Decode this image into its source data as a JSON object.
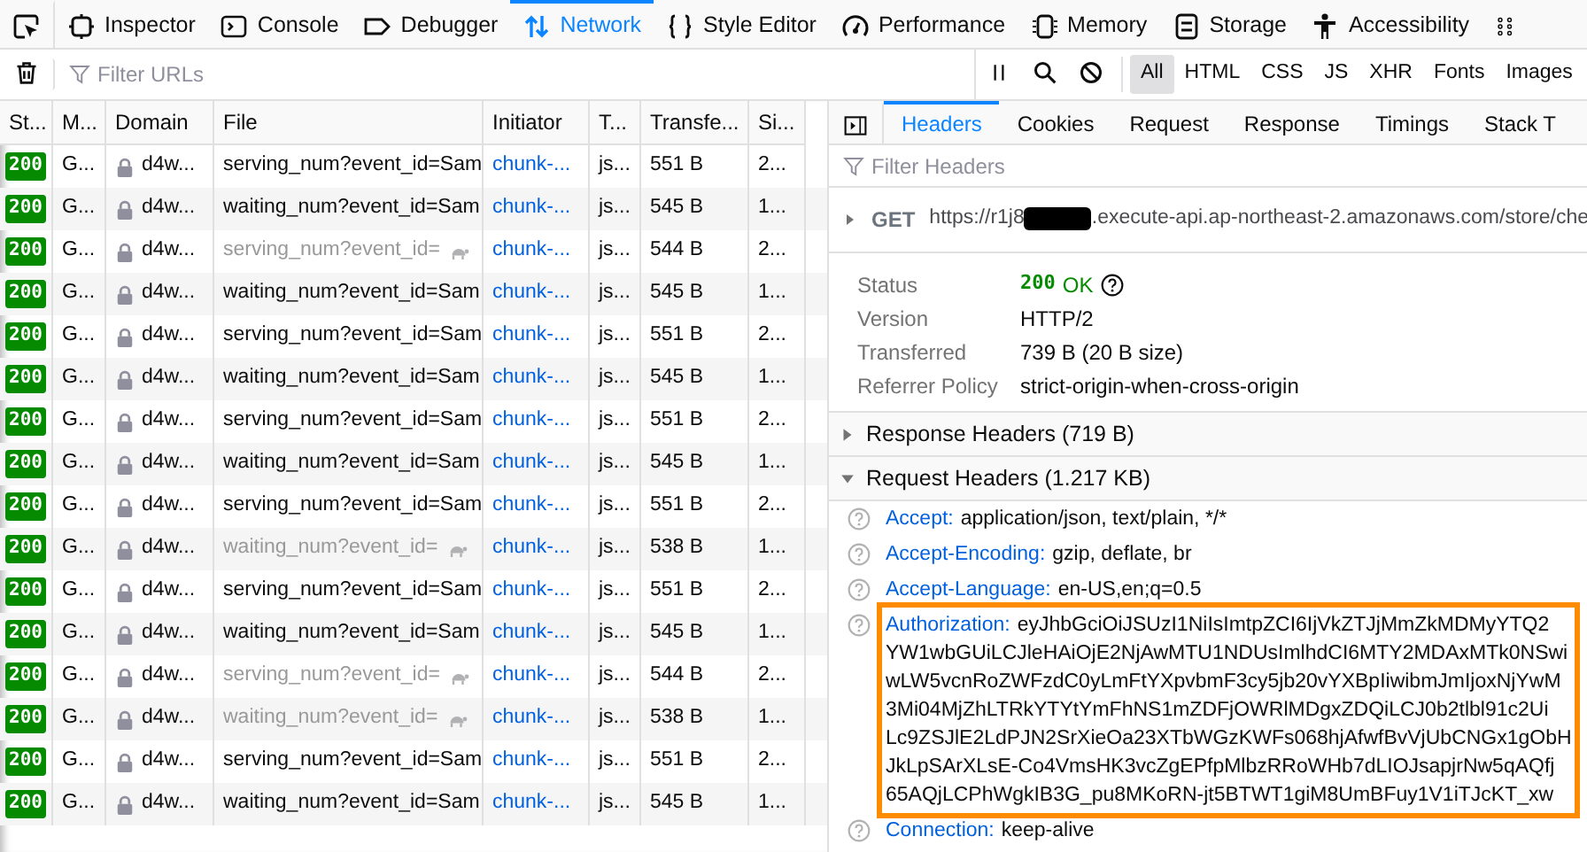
{
  "toolbox_tabs": [
    {
      "label": "Inspector",
      "selected": false
    },
    {
      "label": "Console",
      "selected": false
    },
    {
      "label": "Debugger",
      "selected": false
    },
    {
      "label": "Network",
      "selected": true
    },
    {
      "label": "Style Editor",
      "selected": false
    },
    {
      "label": "Performance",
      "selected": false
    },
    {
      "label": "Memory",
      "selected": false
    },
    {
      "label": "Storage",
      "selected": false
    },
    {
      "label": "Accessibility",
      "selected": false
    }
  ],
  "filter": {
    "placeholder": "Filter URLs"
  },
  "type_filters": [
    {
      "label": "All",
      "selected": true
    },
    {
      "label": "HTML",
      "selected": false
    },
    {
      "label": "CSS",
      "selected": false
    },
    {
      "label": "JS",
      "selected": false
    },
    {
      "label": "XHR",
      "selected": false
    },
    {
      "label": "Fonts",
      "selected": false
    },
    {
      "label": "Images",
      "selected": false
    }
  ],
  "table": {
    "columns": [
      "St...",
      "M...",
      "Domain",
      "File",
      "Initiator",
      "T...",
      "Transfe...",
      "Si..."
    ],
    "rows": [
      {
        "status": "200",
        "method": "G...",
        "domain": "d4w...",
        "file": "serving_num?event_id=Sam",
        "throttled": false,
        "initiator": "chunk-...",
        "type": "js...",
        "transferred": "551 B",
        "size": "2..."
      },
      {
        "status": "200",
        "method": "G...",
        "domain": "d4w...",
        "file": "waiting_num?event_id=Sam",
        "throttled": false,
        "initiator": "chunk-...",
        "type": "js...",
        "transferred": "545 B",
        "size": "1..."
      },
      {
        "status": "200",
        "method": "G...",
        "domain": "d4w...",
        "file": "serving_num?event_id=",
        "throttled": true,
        "initiator": "chunk-...",
        "type": "js...",
        "transferred": "544 B",
        "size": "2..."
      },
      {
        "status": "200",
        "method": "G...",
        "domain": "d4w...",
        "file": "waiting_num?event_id=Sam",
        "throttled": false,
        "initiator": "chunk-...",
        "type": "js...",
        "transferred": "545 B",
        "size": "1..."
      },
      {
        "status": "200",
        "method": "G...",
        "domain": "d4w...",
        "file": "serving_num?event_id=Sam",
        "throttled": false,
        "initiator": "chunk-...",
        "type": "js...",
        "transferred": "551 B",
        "size": "2..."
      },
      {
        "status": "200",
        "method": "G...",
        "domain": "d4w...",
        "file": "waiting_num?event_id=Sam",
        "throttled": false,
        "initiator": "chunk-...",
        "type": "js...",
        "transferred": "545 B",
        "size": "1..."
      },
      {
        "status": "200",
        "method": "G...",
        "domain": "d4w...",
        "file": "serving_num?event_id=Sam",
        "throttled": false,
        "initiator": "chunk-...",
        "type": "js...",
        "transferred": "551 B",
        "size": "2..."
      },
      {
        "status": "200",
        "method": "G...",
        "domain": "d4w...",
        "file": "waiting_num?event_id=Sam",
        "throttled": false,
        "initiator": "chunk-...",
        "type": "js...",
        "transferred": "545 B",
        "size": "1..."
      },
      {
        "status": "200",
        "method": "G...",
        "domain": "d4w...",
        "file": "serving_num?event_id=Sam",
        "throttled": false,
        "initiator": "chunk-...",
        "type": "js...",
        "transferred": "551 B",
        "size": "2..."
      },
      {
        "status": "200",
        "method": "G...",
        "domain": "d4w...",
        "file": "waiting_num?event_id=",
        "throttled": true,
        "initiator": "chunk-...",
        "type": "js...",
        "transferred": "538 B",
        "size": "1..."
      },
      {
        "status": "200",
        "method": "G...",
        "domain": "d4w...",
        "file": "serving_num?event_id=Sam",
        "throttled": false,
        "initiator": "chunk-...",
        "type": "js...",
        "transferred": "551 B",
        "size": "2..."
      },
      {
        "status": "200",
        "method": "G...",
        "domain": "d4w...",
        "file": "waiting_num?event_id=Sam",
        "throttled": false,
        "initiator": "chunk-...",
        "type": "js...",
        "transferred": "545 B",
        "size": "1..."
      },
      {
        "status": "200",
        "method": "G...",
        "domain": "d4w...",
        "file": "serving_num?event_id=",
        "throttled": true,
        "initiator": "chunk-...",
        "type": "js...",
        "transferred": "544 B",
        "size": "2..."
      },
      {
        "status": "200",
        "method": "G...",
        "domain": "d4w...",
        "file": "waiting_num?event_id=",
        "throttled": true,
        "initiator": "chunk-...",
        "type": "js...",
        "transferred": "538 B",
        "size": "1..."
      },
      {
        "status": "200",
        "method": "G...",
        "domain": "d4w...",
        "file": "serving_num?event_id=Sam",
        "throttled": false,
        "initiator": "chunk-...",
        "type": "js...",
        "transferred": "551 B",
        "size": "2..."
      },
      {
        "status": "200",
        "method": "G...",
        "domain": "d4w...",
        "file": "waiting_num?event_id=Sam",
        "throttled": false,
        "initiator": "chunk-...",
        "type": "js...",
        "transferred": "545 B",
        "size": "1..."
      }
    ]
  },
  "detail_tabs": [
    {
      "label": "Headers",
      "selected": true
    },
    {
      "label": "Cookies",
      "selected": false
    },
    {
      "label": "Request",
      "selected": false
    },
    {
      "label": "Response",
      "selected": false
    },
    {
      "label": "Timings",
      "selected": false
    },
    {
      "label": "Stack T",
      "selected": false
    }
  ],
  "header_filter": {
    "placeholder": "Filter Headers"
  },
  "request_line": {
    "method": "GET",
    "url_start": "https://r1j8",
    "redacted": true,
    "url_end": ".execute-api.ap-northeast-2.amazonaws.com/store/che"
  },
  "summary": [
    {
      "label": "Status",
      "value": "OK",
      "code": "200"
    },
    {
      "label": "Version",
      "value": "HTTP/2"
    },
    {
      "label": "Transferred",
      "value": "739 B (20 B size)"
    },
    {
      "label": "Referrer Policy",
      "value": "strict-origin-when-cross-origin"
    }
  ],
  "sections": [
    {
      "title": "Response Headers (719 B)",
      "expanded": false
    },
    {
      "title": "Request Headers (1.217 KB)",
      "expanded": true
    }
  ],
  "request_headers": [
    {
      "name": "Accept:",
      "value_lines": [
        "application/json, text/plain, */*"
      ],
      "highlighted": false
    },
    {
      "name": "Accept-Encoding:",
      "value_lines": [
        "gzip, deflate, br"
      ],
      "highlighted": false
    },
    {
      "name": "Accept-Language:",
      "value_lines": [
        "en-US,en;q=0.5"
      ],
      "highlighted": false
    },
    {
      "name": "Authorization:",
      "value_lines": [
        "eyJhbGciOiJSUzI1NiIsImtpZCI6IjVkZTJjMmZkMDMyYTQ2",
        "YW1wbGUiLCJleHAiOjE2NjAwMTU1NDUsImlhdCI6MTY2MDAxMTk0NSwi",
        "wLW5vcnRoZWFzdC0yLmFtYXpvbmF3cy5jb20vYXBpIiwibmJmIjoxNjYwM",
        "3Mi04MjZhLTRkYTYtYmFhNS1mZDFjOWRlMDgxZDQiLCJ0b2tlbl91c2Ui",
        "Lc9ZSJlE2LdPJN2SrXieOa23XTbWGzKWFs068hjAfwfBvVjUbCNGx1gObH",
        "JkLpSArXLsE-Co4VmsHK3vcZgEPfpMlbzRRoWHb7dLIOJsapjrNw5qAQfj",
        "65AQjLCPhWgkIB3G_pu8MKoRN-jt5BTWT1giM8UmBFuy1V1iTJcKT_xw"
      ],
      "highlighted": true
    },
    {
      "name": "Connection:",
      "value_lines": [
        "keep-alive"
      ],
      "highlighted": false
    }
  ]
}
